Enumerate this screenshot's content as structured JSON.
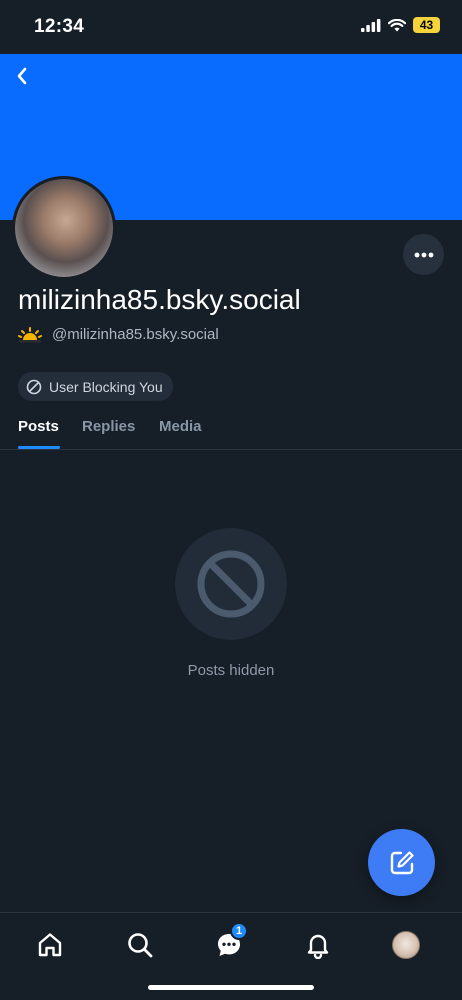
{
  "status_bar": {
    "time": "12:34",
    "battery": "43"
  },
  "profile": {
    "display_name": "milizinha85.bsky.social",
    "handle": "@milizinha85.bsky.social",
    "block_badge": "User Blocking You"
  },
  "tabs": [
    {
      "label": "Posts",
      "active": true
    },
    {
      "label": "Replies",
      "active": false
    },
    {
      "label": "Media",
      "active": false
    }
  ],
  "empty_state": {
    "text": "Posts hidden"
  },
  "bottom_nav": {
    "chat_badge": "1"
  },
  "colors": {
    "banner": "#0a6bff",
    "background": "#161e27",
    "accent": "#208bfe",
    "fab": "#3d7cf5"
  }
}
